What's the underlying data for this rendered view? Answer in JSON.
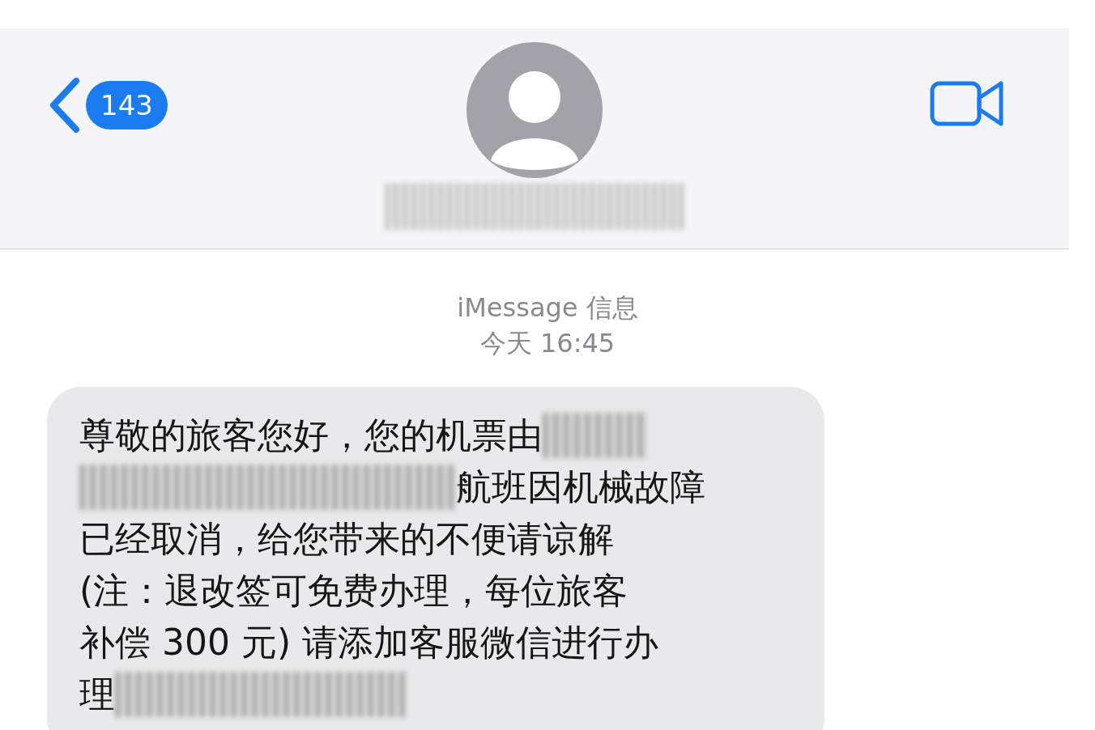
{
  "header": {
    "unread_count": "143"
  },
  "thread_meta": {
    "service": "iMessage 信息",
    "timestamp": "今天 16:45"
  },
  "message": {
    "lines": [
      [
        {
          "kind": "text",
          "text": "尊敬的旅客您好，您的机票由"
        },
        {
          "kind": "redaction"
        }
      ],
      [
        {
          "kind": "redaction"
        },
        {
          "kind": "text",
          "text": "航班因机械故障"
        }
      ],
      [
        {
          "kind": "text",
          "text": "已经取消，给您带来的不便请谅解"
        }
      ],
      [
        {
          "kind": "text",
          "text": "(注：退改签可免费办理，每位旅客"
        }
      ],
      [
        {
          "kind": "text",
          "text": "补偿 300 元) 请添加客服微信进行办"
        }
      ],
      [
        {
          "kind": "text",
          "text": "理"
        },
        {
          "kind": "redaction"
        }
      ]
    ]
  }
}
